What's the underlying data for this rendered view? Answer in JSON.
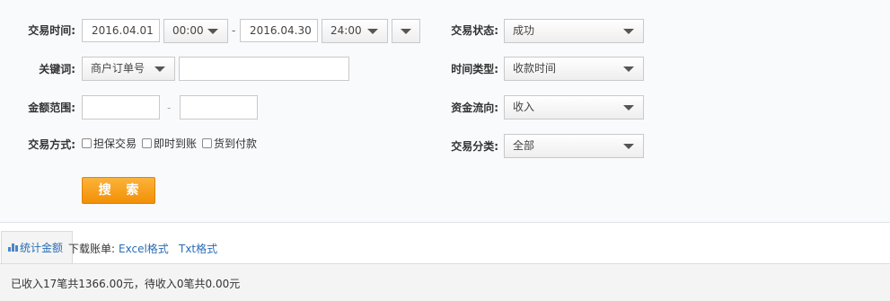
{
  "form": {
    "trade_time_label": "交易时间:",
    "start_date": "2016.04.01",
    "start_time": "00:00",
    "range_dash": "-",
    "end_date": "2016.04.30",
    "end_time": "24:00",
    "keyword_label": "关键词:",
    "keyword_type": "商户订单号",
    "keyword_value": "",
    "amount_label": "金额范围:",
    "amount_min": "",
    "amount_dash": "-",
    "amount_max": "",
    "method_label": "交易方式:",
    "methods": [
      "担保交易",
      "即时到账",
      "货到付款"
    ],
    "status_label": "交易状态:",
    "status_value": "成功",
    "time_type_label": "时间类型:",
    "time_type_value": "收款时间",
    "flow_label": "资金流向:",
    "flow_value": "收入",
    "category_label": "交易分类:",
    "category_value": "全部",
    "search_button": "搜 索"
  },
  "results": {
    "tab_label": "统计金额",
    "download_label": "下载账单:",
    "excel_link": "Excel格式",
    "txt_link": "Txt格式",
    "summary_text": "已收入17笔共1366.00元，待收入0笔共0.00元"
  },
  "colors": {
    "search_button": "#f29005",
    "link": "#2a6cb4"
  }
}
